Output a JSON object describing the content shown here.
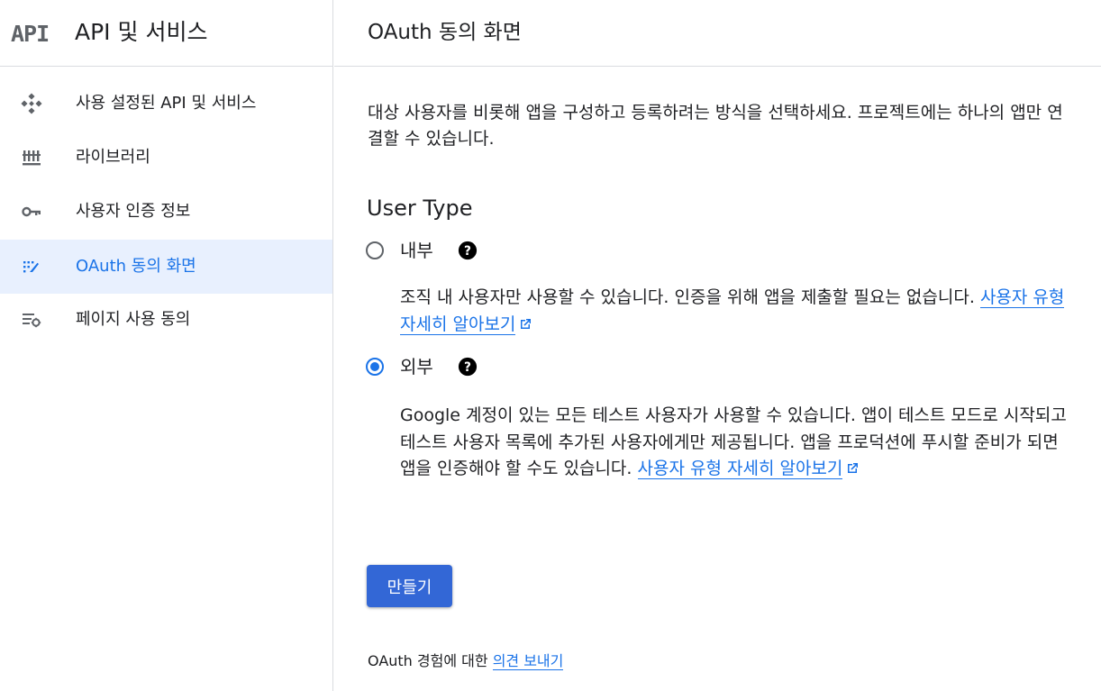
{
  "sidebar": {
    "logo": "API",
    "title": "API 및 서비스",
    "items": [
      {
        "label": "사용 설정된 API 및 서비스",
        "icon": "diamond-grid-icon",
        "active": false
      },
      {
        "label": "라이브러리",
        "icon": "library-icon",
        "active": false
      },
      {
        "label": "사용자 인증 정보",
        "icon": "key-icon",
        "active": false
      },
      {
        "label": "OAuth 동의 화면",
        "icon": "oauth-consent-icon",
        "active": true
      },
      {
        "label": "페이지 사용 동의",
        "icon": "settings-list-icon",
        "active": false
      }
    ]
  },
  "header": {
    "title": "OAuth 동의 화면"
  },
  "main": {
    "intro": "대상 사용자를 비롯해 앱을 구성하고 등록하려는 방식을 선택하세요. 프로젝트에는 하나의 앱만 연결할 수 있습니다.",
    "user_type_title": "User Type",
    "options": [
      {
        "label": "내부",
        "checked": false,
        "description": "조직 내 사용자만 사용할 수 있습니다. 인증을 위해 앱을 제출할 필요는 없습니다.",
        "link": "사용자 유형 자세히 알아보기"
      },
      {
        "label": "외부",
        "checked": true,
        "description": "Google 계정이 있는 모든 테스트 사용자가 사용할 수 있습니다. 앱이 테스트 모드로 시작되고 테스트 사용자 목록에 추가된 사용자에게만 제공됩니다. 앱을 프로덕션에 푸시할 준비가 되면 앱을 인증해야 할 수도 있습니다.",
        "link": "사용자 유형 자세히 알아보기"
      }
    ],
    "create_button": "만들기",
    "feedback_text": "OAuth 경험에 대한",
    "feedback_link": "의견 보내기"
  },
  "colors": {
    "accent": "#1a73e8",
    "button": "#3367d6",
    "active_bg": "#e8f0fe",
    "divider": "#dadce0"
  }
}
